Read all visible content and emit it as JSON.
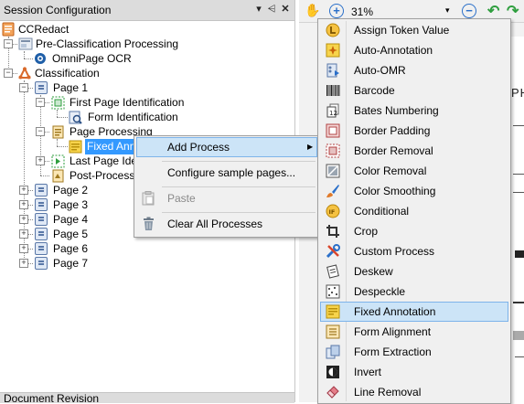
{
  "left_panel": {
    "title": "Session Configuration",
    "pin_glyph": "⩤",
    "close_glyph": "✕",
    "dropdown_glyph": "▾",
    "tree": {
      "root": "CCRedact",
      "pre_classification": "Pre-Classification Processing",
      "omnipage": "OmniPage OCR",
      "classification": "Classification",
      "page1": "Page 1",
      "first_page_id": "First Page Identification",
      "form_id": "Form Identification",
      "page_processing": "Page Processing",
      "fixed_annotation": "Fixed Anno",
      "last_page_id": "Last Page Ider",
      "post_processing": "Post-Processin",
      "pages": [
        "Page 2",
        "Page 3",
        "Page 4",
        "Page 5",
        "Page 6",
        "Page 7"
      ]
    }
  },
  "bottom_panel": {
    "title": "Document Revision"
  },
  "toolbar": {
    "zoom_value": "31%",
    "hand_glyph": "✋",
    "zoom_in_glyph": "+",
    "zoom_out_glyph": "−",
    "undo_glyph": "↶",
    "redo_glyph": "↷"
  },
  "doc_fragment": "PH",
  "context_menu": {
    "add_process": "Add Process",
    "submenu_arrow": "▶",
    "configure": "Configure sample pages...",
    "paste": "Paste",
    "clear": "Clear All Processes"
  },
  "process_menu": {
    "items": [
      "Assign Token Value",
      "Auto-Annotation",
      "Auto-OMR",
      "Barcode",
      "Bates Numbering",
      "Border Padding",
      "Border Removal",
      "Color Removal",
      "Color Smoothing",
      "Conditional",
      "Crop",
      "Custom Process",
      "Deskew",
      "Despeckle",
      "Fixed Annotation",
      "Form Alignment",
      "Form Extraction",
      "Invert",
      "Line Removal"
    ],
    "selected": "Fixed Annotation"
  },
  "colors": {
    "selection_fill": "#cce4f7",
    "selection_border": "#7eb4ea",
    "tree_selection": "#3399ff",
    "accent_green": "#2e9e3e",
    "accent_blue": "#2a6fc9",
    "accent_orange": "#e07a2a"
  }
}
